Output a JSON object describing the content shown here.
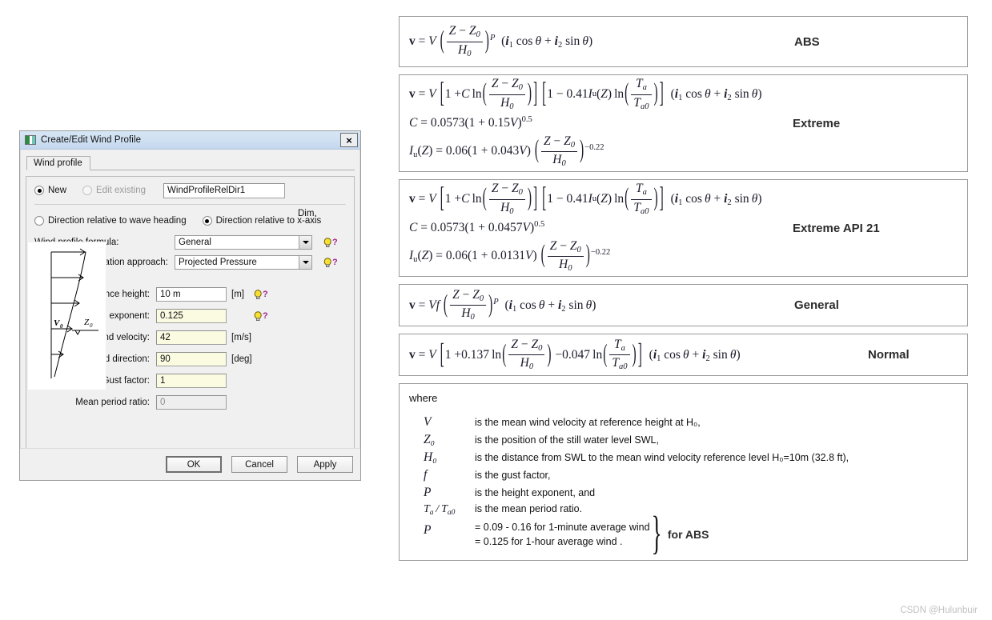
{
  "dialog": {
    "title": "Create/Edit Wind Profile",
    "title_icon": "window-icon",
    "close_icon": "×",
    "tab_label": "Wind profile",
    "mode": {
      "new_label": "New",
      "new_selected": true,
      "edit_label": "Edit existing",
      "edit_selected": false,
      "edit_disabled": true,
      "name_value": "WindProfileRelDir1"
    },
    "direction": {
      "rel_wave_label": "Direction relative to wave heading",
      "rel_wave_selected": false,
      "rel_x_label": "Direction relative to x-axis",
      "rel_x_selected": true
    },
    "formula_row": {
      "label": "Wind profile formula:",
      "value": "General",
      "help_icon": "lightbulb-help-icon"
    },
    "approach_row": {
      "label": "Wind force calculation approach:",
      "value": "Projected Pressure",
      "help_icon": "lightbulb-help-icon"
    },
    "dim_header": "Dim.",
    "fields": [
      {
        "label": "Reference height:",
        "value": "10 m",
        "dim": "[m]",
        "style": "white",
        "help": true
      },
      {
        "label": "Wind profile exponent:",
        "value": "0.125",
        "dim": "",
        "style": "yellow",
        "help": true
      },
      {
        "label": "Average wind velocity:",
        "value": "42",
        "dim": "[m/s]",
        "style": "yellow",
        "help": false
      },
      {
        "label": "Wind direction:",
        "value": "90",
        "dim": "[deg]",
        "style": "yellow",
        "help": false
      },
      {
        "label": "Gust factor:",
        "value": "1",
        "dim": "",
        "style": "yellow",
        "help": false
      },
      {
        "label": "Mean period ratio:",
        "value": "0",
        "dim": "",
        "style": "disabled",
        "help": false
      }
    ],
    "profile_graphic": {
      "name": "wind-profile-sketch",
      "label_v": "V",
      "label_v_sub": "0",
      "label_z": "Z",
      "label_z_sub": "0"
    },
    "buttons": {
      "ok": "OK",
      "cancel": "Cancel",
      "apply": "Apply"
    }
  },
  "formulas": [
    {
      "name": "ABS"
    },
    {
      "name": "Extreme",
      "c_coeff": "0.15",
      "iu_coeff": "0.043"
    },
    {
      "name": "Extreme API 21",
      "c_coeff": "0.0457",
      "iu_coeff": "0.0131"
    },
    {
      "name": "General"
    },
    {
      "name": "Normal",
      "a_coeff": "0.137",
      "b_coeff": "0.047"
    }
  ],
  "where": {
    "title": "where",
    "definitions": [
      {
        "symbol": "V",
        "desc": "is the mean wind velocity at reference height at H₀,"
      },
      {
        "symbol": "Z₀",
        "desc": "is the position of the still water level SWL,"
      },
      {
        "symbol": "H₀",
        "desc": "is the distance from SWL to the mean wind velocity reference level H₀=10m (32.8 ft),"
      },
      {
        "symbol": "f",
        "desc": "is the gust factor,"
      },
      {
        "symbol": "P",
        "desc": "is the height exponent, and"
      },
      {
        "symbol": "Ta/Ta0",
        "desc": "is the mean period ratio."
      }
    ],
    "p_values": {
      "symbol": "P",
      "line1": "= 0.09 - 0.16 for 1-minute average wind",
      "line2": "= 0.125 for 1-hour average wind .",
      "annotation": "for ABS"
    }
  },
  "watermark": "CSDN @Hulunbuir"
}
